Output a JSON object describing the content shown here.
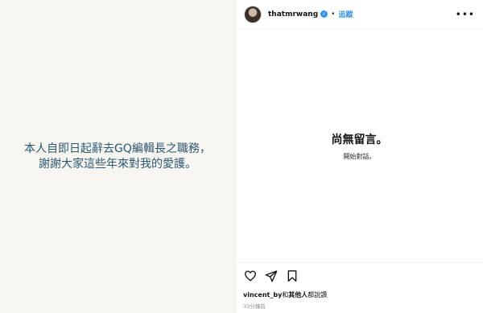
{
  "post": {
    "caption_line1": "本人自即日起辭去GQ編輯長之職務，",
    "caption_line2": "謝謝大家這些年來對我的愛護。"
  },
  "header": {
    "username": "thatmrwang",
    "separator": "•",
    "follow_label": "追蹤",
    "more_icon": "more-horizontal-icon"
  },
  "comments": {
    "empty_title": "尚無留言。",
    "empty_subtitle": "開始對話。"
  },
  "actions": {
    "like_icon": "heart-icon",
    "share_icon": "send-icon",
    "save_icon": "bookmark-icon"
  },
  "likes": {
    "user": "vincent_by",
    "suffix_pre": "和",
    "others": "其他人",
    "suffix_post": "都說讚"
  },
  "timestamp": "33分鐘前",
  "colors": {
    "accent": "#2f93f1",
    "caption": "#2a5874",
    "image_bg": "#f6f5f0"
  }
}
